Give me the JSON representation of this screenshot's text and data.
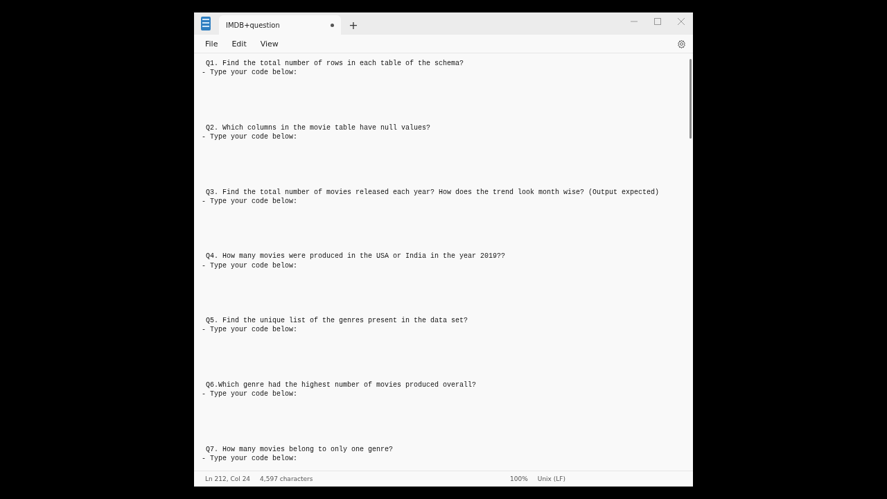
{
  "window": {
    "tab": {
      "title": "IMDB+question",
      "modified": true,
      "selected": true
    },
    "new_tab": "+"
  },
  "menu": [
    "File",
    "Edit",
    "View"
  ],
  "document": [
    {
      "question": "Q1. Find the total number of rows in each table of the schema?",
      "prompt": "- Type your code below:"
    },
    {
      "question": "Q2. Which columns in the movie table have null values?",
      "prompt": "- Type your code below:"
    },
    {
      "question": "Q3. Find the total number of movies released each year? How does the trend look month wise? (Output expected)",
      "prompt": "- Type your code below:"
    },
    {
      "question": "Q4. How many movies were produced in the USA or India in the year 2019??",
      "prompt": "- Type your code below:"
    },
    {
      "question": "Q5. Find the unique list of the genres present in the data set?",
      "prompt": "- Type your code below:"
    },
    {
      "question": "Q6.Which genre had the highest number of movies produced overall?",
      "prompt": "- Type your code below:"
    },
    {
      "question": "Q7. How many movies belong to only one genre?",
      "prompt": "- Type your code below:"
    }
  ],
  "status_bar": {
    "position": "Ln 212, Col 24",
    "characters": "4,597 characters",
    "zoom": "100%",
    "line_endings": "Unix (LF)"
  }
}
